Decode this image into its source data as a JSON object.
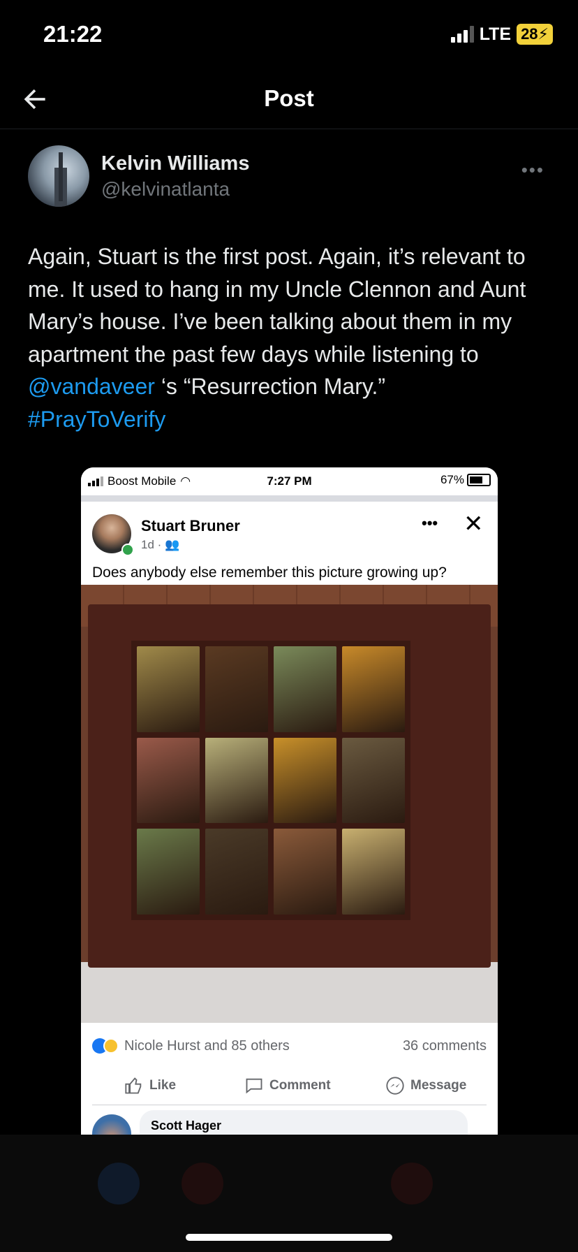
{
  "status_bar": {
    "time": "21:22",
    "network": "LTE",
    "battery": "28"
  },
  "nav": {
    "title": "Post"
  },
  "author": {
    "name": "Kelvin Williams",
    "handle": "@kelvinatlanta"
  },
  "post": {
    "text_1": "Again, Stuart is the first post. Again, it’s relevant to me. It used to hang in my Uncle Clennon and Aunt Mary’s house. I’ve been talking about them in my apartment the past few days while listening to ",
    "mention": "@vandaveer",
    "text_2": " ‘s “Resurrection Mary.”",
    "hashtag": "#PrayToVerify"
  },
  "embedded": {
    "status": {
      "carrier": "Boost Mobile",
      "time": "7:27 PM",
      "battery": "67%"
    },
    "fb_post": {
      "author": "Stuart Bruner",
      "meta": "1d ·",
      "text": "Does anybody else remember this picture growing up?"
    },
    "reactions": {
      "summary": "Nicole Hurst and 85 others",
      "comments": "36 comments"
    },
    "actions": {
      "like": "Like",
      "comment": "Comment",
      "message": "Message"
    },
    "comment": {
      "name": "Scott Hager"
    }
  },
  "colors": {
    "link": "#1d9bf0",
    "fb_blue": "#1877f2",
    "background": "#000000"
  }
}
